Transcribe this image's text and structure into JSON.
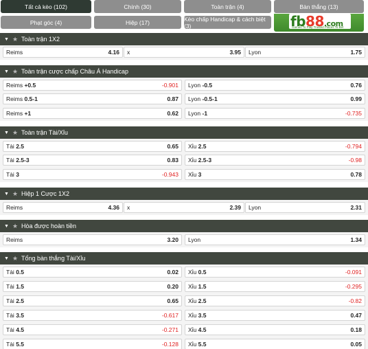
{
  "tabs": [
    {
      "label": "Tất cả kèo (102)",
      "active": true
    },
    {
      "label": "Chính (30)",
      "active": false
    },
    {
      "label": "Toàn trận (4)",
      "active": false
    },
    {
      "label": "Bàn thắng (13)",
      "active": false
    },
    {
      "label": "Phạt góc (4)",
      "active": false
    },
    {
      "label": "Hiệp (17)",
      "active": false
    },
    {
      "label": "Kèo chấp Handicap & cách biệt (3)",
      "active": false
    }
  ],
  "logo": {
    "fb": "fb",
    "n88": "88",
    "com": ".com",
    "tagline": "Games To Play  Trusted Places To Bet"
  },
  "sections": [
    {
      "title": "Toàn trận 1X2",
      "rows": [
        [
          {
            "label": "Reims",
            "odds": "4.16"
          },
          {
            "label": "x",
            "odds": "3.95"
          },
          {
            "label": "Lyon",
            "odds": "1.75"
          }
        ]
      ]
    },
    {
      "title": "Toàn trận cược chấp Châu Á Handicap",
      "rows": [
        [
          {
            "label": "Reims",
            "line": "+0.5",
            "odds": "-0.901"
          },
          {
            "label": "Lyon",
            "line": "-0.5",
            "odds": "0.76"
          }
        ],
        [
          {
            "label": "Reims",
            "line": "0.5-1",
            "odds": "0.87"
          },
          {
            "label": "Lyon",
            "line": "-0.5-1",
            "odds": "0.99"
          }
        ],
        [
          {
            "label": "Reims",
            "line": "+1",
            "odds": "0.62"
          },
          {
            "label": "Lyon",
            "line": "-1",
            "odds": "-0.735"
          }
        ]
      ]
    },
    {
      "title": "Toàn trận Tài/Xỉu",
      "rows": [
        [
          {
            "label": "Tài",
            "line": "2.5",
            "odds": "0.65"
          },
          {
            "label": "Xỉu",
            "line": "2.5",
            "odds": "-0.794"
          }
        ],
        [
          {
            "label": "Tài",
            "line": "2.5-3",
            "odds": "0.83"
          },
          {
            "label": "Xỉu",
            "line": "2.5-3",
            "odds": "-0.98"
          }
        ],
        [
          {
            "label": "Tài",
            "line": "3",
            "odds": "-0.943"
          },
          {
            "label": "Xỉu",
            "line": "3",
            "odds": "0.78"
          }
        ]
      ]
    },
    {
      "title": "Hiệp 1 Cược 1X2",
      "rows": [
        [
          {
            "label": "Reims",
            "odds": "4.36"
          },
          {
            "label": "x",
            "odds": "2.39"
          },
          {
            "label": "Lyon",
            "odds": "2.31"
          }
        ]
      ]
    },
    {
      "title": "Hòa được hoàn tiền",
      "rows": [
        [
          {
            "label": "Reims",
            "odds": "3.20"
          },
          {
            "label": "Lyon",
            "odds": "1.34"
          }
        ]
      ]
    },
    {
      "title": "Tổng bàn thắng Tài/Xỉu",
      "rows": [
        [
          {
            "label": "Tài",
            "line": "0.5",
            "odds": "0.02"
          },
          {
            "label": "Xỉu",
            "line": "0.5",
            "odds": "-0.091"
          }
        ],
        [
          {
            "label": "Tài",
            "line": "1.5",
            "odds": "0.20"
          },
          {
            "label": "Xỉu",
            "line": "1.5",
            "odds": "-0.295"
          }
        ],
        [
          {
            "label": "Tài",
            "line": "2.5",
            "odds": "0.65"
          },
          {
            "label": "Xỉu",
            "line": "2.5",
            "odds": "-0.82"
          }
        ],
        [
          {
            "label": "Tài",
            "line": "3.5",
            "odds": "-0.617"
          },
          {
            "label": "Xỉu",
            "line": "3.5",
            "odds": "0.47"
          }
        ],
        [
          {
            "label": "Tài",
            "line": "4.5",
            "odds": "-0.271"
          },
          {
            "label": "Xỉu",
            "line": "4.5",
            "odds": "0.18"
          }
        ],
        [
          {
            "label": "Tài",
            "line": "5.5",
            "odds": "-0.128"
          },
          {
            "label": "Xỉu",
            "line": "5.5",
            "odds": "0.05"
          }
        ]
      ]
    }
  ],
  "icons": {
    "collapse": "chevron-down-icon",
    "favorite": "star-icon"
  },
  "colors": {
    "negative_odds": "#e02020",
    "header_bg": "#41473f",
    "tab_active": "#2f3a33",
    "tab_inactive": "#8e8e8e"
  }
}
